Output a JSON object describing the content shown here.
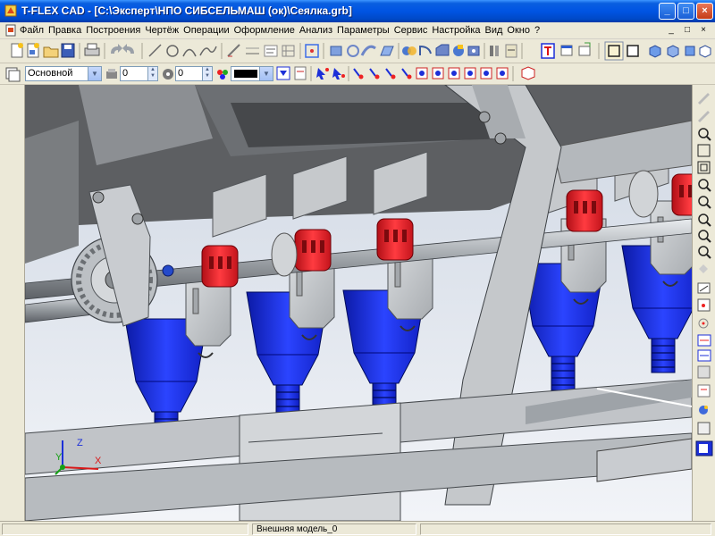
{
  "window": {
    "title": "T-FLEX CAD - [C:\\Эксперт\\НПО СИБСЕЛЬМАШ (ок)\\Сеялка.grb]",
    "controls": [
      "_",
      "□",
      "×"
    ]
  },
  "menu": {
    "items": [
      "Файл",
      "Правка",
      "Построения",
      "Чертёж",
      "Операции",
      "Оформление",
      "Анализ",
      "Параметры",
      "Сервис",
      "Настройка",
      "Вид",
      "Окно",
      "?"
    ],
    "mdi_controls": [
      "_",
      "□",
      "×"
    ]
  },
  "toolbar2": {
    "layer_select": "Основной",
    "level_value": "0",
    "priority_value": "0",
    "color_swatch": "#000000"
  },
  "status": {
    "model_name": "Внешняя модель_0"
  },
  "axes": {
    "x_label": "X",
    "y_label": "Y",
    "z_label": "Z"
  },
  "colors": {
    "hopper_blue": "#1c2fd8",
    "coupling_red": "#e0222a",
    "frame_grey": "#bfc3c7",
    "titlebar_blue": "#0054e3"
  },
  "icons": {
    "toolbar1": [
      "new-file-icon",
      "new-3d-icon",
      "open-icon",
      "save-icon",
      "print-icon",
      "undo-icon",
      "redo-icon",
      "line-icon",
      "circle-icon",
      "arc-icon",
      "spline-icon",
      "hatch-icon",
      "dimension-icon",
      "text-icon",
      "grid-icon",
      "snap-icon",
      "extrude-icon",
      "rotate-icon",
      "sweep-icon",
      "loft-icon",
      "boolean-icon",
      "fillet-icon",
      "chamfer-icon",
      "shell-icon",
      "hole-icon",
      "array-icon",
      "section-icon",
      "measure-icon",
      "window-icon",
      "viewports-icon",
      "wireframe-icon",
      "shaded-icon"
    ],
    "right_toolbar": [
      "pencil-icon",
      "pencil-grey-icon",
      "zoom-in-icon",
      "zoom-extents-icon",
      "zoom-window-icon",
      "zoom-out-icon",
      "pan-icon",
      "rotate-view-icon",
      "zoom-previous-icon",
      "zoom-all-icon",
      "zoom-frame-icon",
      "arrow-icon",
      "properties-icon",
      "dimension-tool-icon",
      "snap-point-icon",
      "measure-tool-icon",
      "layer-tool-icon",
      "section-tool-icon",
      "view-tool-icon",
      "render-tool-icon",
      "shaded-view-icon"
    ]
  }
}
